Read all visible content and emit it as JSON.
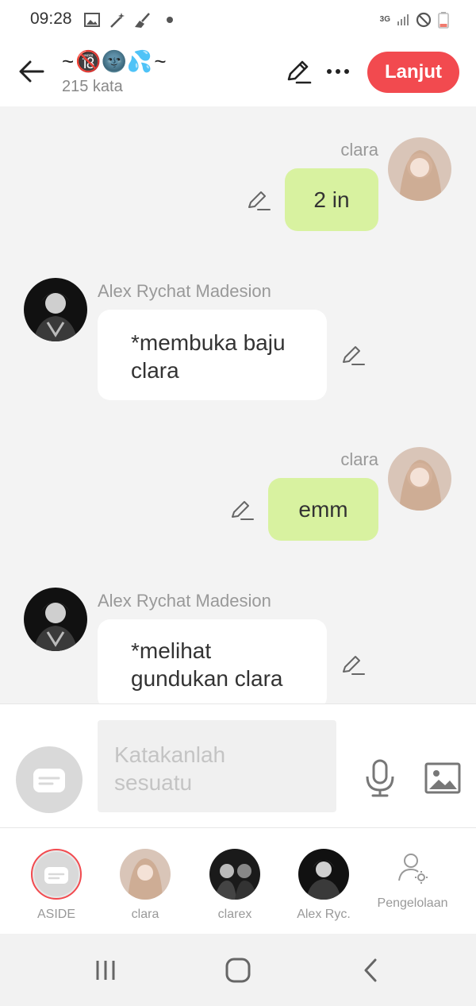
{
  "status": {
    "time": "09:28",
    "network": "3G"
  },
  "header": {
    "title_prefix": "~",
    "title_emoji": "🔞🌚💦",
    "title_suffix": "~",
    "word_count": "215 kata",
    "continue_label": "Lanjut"
  },
  "messages": [
    {
      "sender": "clara",
      "text": "2 in",
      "side": "right"
    },
    {
      "sender": "Alex Rychat Madesion",
      "text_lines": [
        "*membuka baju",
        "clara"
      ],
      "side": "left"
    },
    {
      "sender": "clara",
      "text": "emm",
      "side": "right"
    },
    {
      "sender": "Alex Rychat Madesion",
      "text_lines": [
        "*melihat",
        "gundukan clara"
      ],
      "side": "left"
    }
  ],
  "composer": {
    "placeholder_lines": [
      "Katakanlah",
      "sesuatu"
    ]
  },
  "characters": [
    {
      "label": "ASIDE"
    },
    {
      "label": "clara"
    },
    {
      "label": "clarex"
    },
    {
      "label": "Alex Ryc."
    },
    {
      "label": "Pengelolaan"
    }
  ],
  "colors": {
    "accent": "#f24a4f",
    "my_bubble": "#d8f2a0",
    "other_bubble": "#ffffff",
    "background": "#f3f3f3"
  }
}
